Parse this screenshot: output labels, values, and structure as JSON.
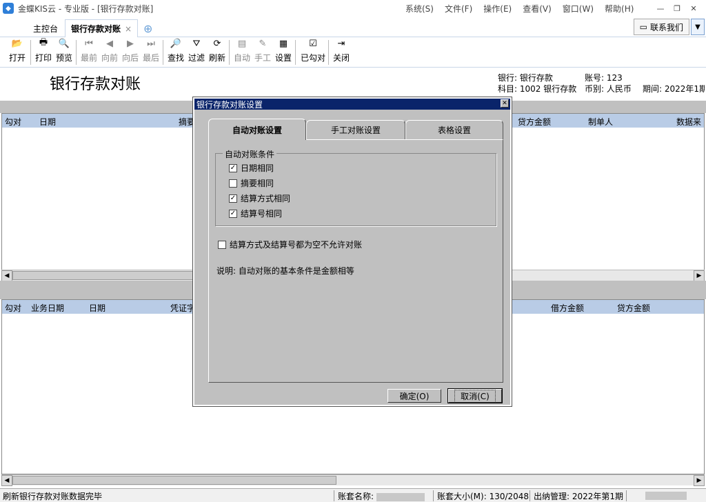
{
  "window": {
    "title": "金蝶KIS云 - 专业版 - [银行存款对账]",
    "menus": [
      "系统(S)",
      "文件(F)",
      "操作(E)",
      "查看(V)",
      "窗口(W)",
      "帮助(H)"
    ]
  },
  "tabs": {
    "home": "主控台",
    "active": "银行存款对账",
    "contact": "联系我们"
  },
  "toolbar": {
    "open": "打开",
    "print": "打印",
    "preview": "预览",
    "first": "最前",
    "prev": "向前",
    "next": "向后",
    "last": "最后",
    "find": "查找",
    "filter": "过滤",
    "refresh": "刷新",
    "auto": "自动",
    "manual": "手工",
    "settings": "设置",
    "checked": "已勾对",
    "close": "关闭"
  },
  "header": {
    "title": "银行存款对账",
    "bank": "银行: 银行存款",
    "account_no": "账号: 123",
    "subject": "科目: 1002 银行存款",
    "currency": "币别: 人民币",
    "period": "期间: 2022年1期"
  },
  "upper_grid": {
    "columns": [
      "勾对",
      "日期",
      "摘要",
      "贷方金额",
      "制单人",
      "数据来"
    ]
  },
  "lower_grid": {
    "columns": [
      "勾对",
      "业务日期",
      "日期",
      "凭证字",
      "借方金额",
      "贷方金额"
    ]
  },
  "dialog": {
    "title": "银行存款对账设置",
    "tabs": [
      "自动对账设置",
      "手工对账设置",
      "表格设置"
    ],
    "group_title": "自动对账条件",
    "conditions": [
      {
        "label": "日期相同",
        "checked": true
      },
      {
        "label": "摘要相同",
        "checked": false
      },
      {
        "label": "结算方式相同",
        "checked": true
      },
      {
        "label": "结算号相同",
        "checked": true
      }
    ],
    "empty_option": {
      "label": "结算方式及结算号都为空不允许对账",
      "checked": false
    },
    "note": "说明: 自动对账的基本条件是金额相等",
    "ok": "确定(O)",
    "cancel": "取消(C)"
  },
  "status": {
    "message": "刷新银行存款对账数据完毕",
    "book_name_label": "账套名称:",
    "book_size": "账套大小(M): 130/2048",
    "period": "出纳管理: 2022年第1期"
  }
}
